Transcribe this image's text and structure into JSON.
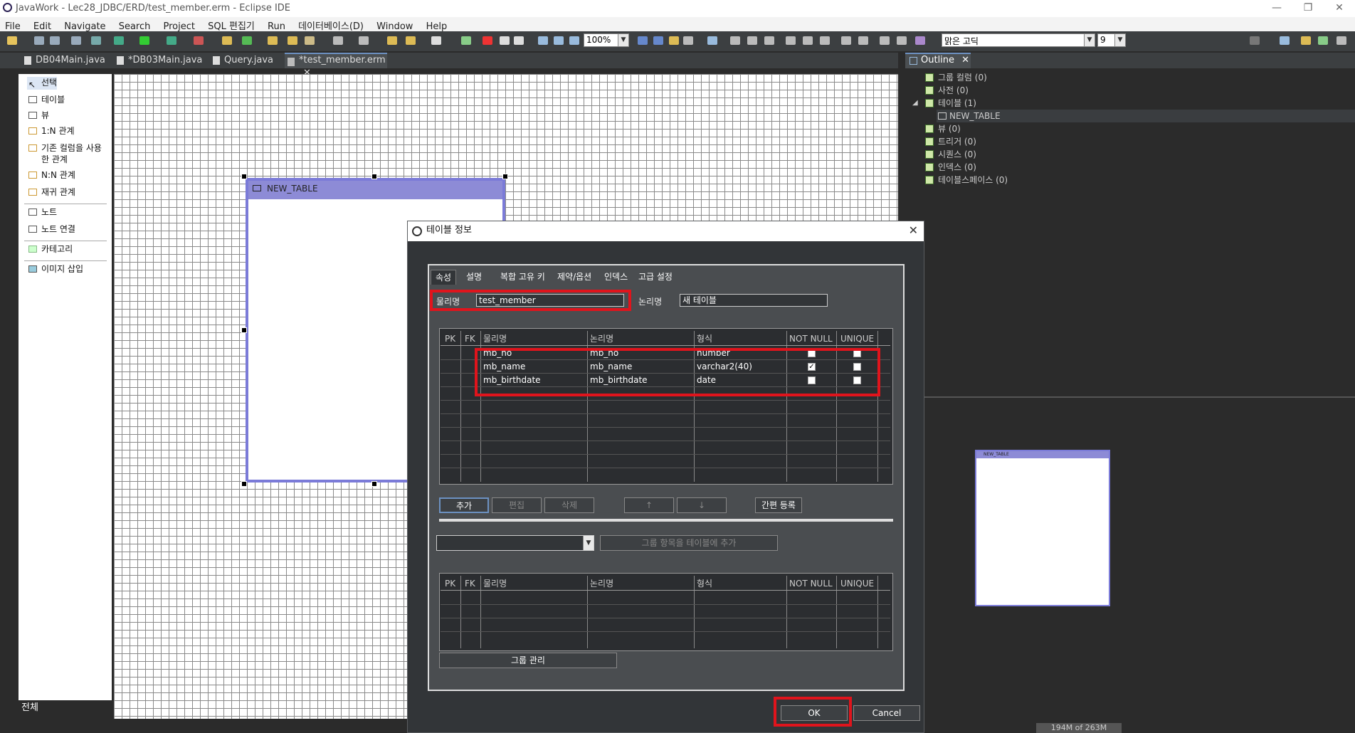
{
  "window": {
    "title": "JavaWork - Lec28_JDBC/ERD/test_member.erm - Eclipse IDE",
    "minimize": "—",
    "restore": "❐",
    "close": "✕"
  },
  "menu": [
    "File",
    "Edit",
    "Navigate",
    "Search",
    "Project",
    "SQL 편집기",
    "Run",
    "데이터베이스(D)",
    "Window",
    "Help"
  ],
  "toolbar": {
    "zoom": "100%",
    "font": "맑은 고딕",
    "font_size": "9"
  },
  "editor_tabs": [
    {
      "label": "DB04Main.java"
    },
    {
      "label": "*DB03Main.java"
    },
    {
      "label": "Query.java"
    },
    {
      "label": "*test_member.erm",
      "close": "✕"
    }
  ],
  "palette": {
    "items": [
      "선택",
      "테이블",
      "뷰",
      "1:N 관계",
      "기존 컬럼을 사용한 관계",
      "N:N 관계",
      "재귀 관계",
      "노트",
      "노트 연결",
      "카테고리",
      "이미지 삽입"
    ],
    "footer": "전체"
  },
  "canvas": {
    "table_name": "NEW_TABLE"
  },
  "outline": {
    "title": "Outline",
    "close": "✕",
    "items": [
      "그룹 컬럼 (0)",
      "사전 (0)",
      "테이블 (1)",
      "NEW_TABLE",
      "뷰 (0)",
      "트리거 (0)",
      "시퀀스 (0)",
      "인덱스 (0)",
      "테이블스페이스 (0)"
    ]
  },
  "overview": {
    "mini_table": "NEW_TABLE"
  },
  "status": {
    "memory": "194M of 263M"
  },
  "dialog": {
    "title": "테이블 정보",
    "close": "✕",
    "tabs": [
      "속성",
      "설명",
      "복합 고유 키",
      "제약/옵션",
      "인덱스",
      "고급 설정"
    ],
    "physical_label": "물리명",
    "physical_value": "test_member",
    "logical_label": "논리명",
    "logical_value": "새 테이블",
    "columns_header": [
      "PK",
      "FK",
      "물리명",
      "논리명",
      "형식",
      "NOT NULL",
      "UNIQUE"
    ],
    "rows": [
      {
        "physical": "mb_no",
        "logical": "mb_no",
        "type": "number",
        "not_null": false,
        "unique": false
      },
      {
        "physical": "mb_name",
        "logical": "mb_name",
        "type": "varchar2(40)",
        "not_null": true,
        "unique": false
      },
      {
        "physical": "mb_birthdate",
        "logical": "mb_birthdate",
        "type": "date",
        "not_null": false,
        "unique": false
      }
    ],
    "buttons": {
      "add": "추가",
      "edit": "편집",
      "delete": "삭제",
      "up": "↑",
      "down": "↓",
      "quick": "간편 등록"
    },
    "group_add": "그룹 항목을 테이블에 추가",
    "group_manage": "그룹 관리",
    "ok": "OK",
    "cancel": "Cancel"
  },
  "colors": {
    "highlight": "#e0141c",
    "table_header": "#8d8bd6",
    "dark_bg": "#2b2b2b"
  }
}
